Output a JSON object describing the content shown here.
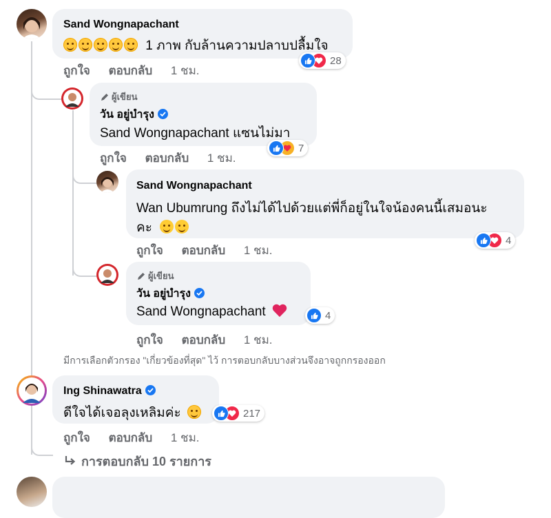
{
  "comments": [
    {
      "author": "Sand Wongnapachant",
      "text": "1 ภาพ กับล้านความปลาบปลื้มใจ",
      "reaction_count": "28",
      "like_label": "ถูกใจ",
      "reply_label": "ตอบกลับ",
      "time": "1 ชม."
    },
    {
      "author_tag": "ผู้เขียน",
      "author": "วัน อยู่บำรุง",
      "mention": "Sand Wongnapachant",
      "text": "แซนไม่มา",
      "reaction_count": "7",
      "like_label": "ถูกใจ",
      "reply_label": "ตอบกลับ",
      "time": "1 ชม."
    },
    {
      "author": "Sand Wongnapachant",
      "mention": "Wan Ubumrung",
      "text_line1": "ถึงไม่ได้ไปด้วยแต่พี่ก็อยู่ในใจน้องคนนี้เสมอนะ",
      "text_line2": "คะ",
      "reaction_count": "4",
      "like_label": "ถูกใจ",
      "reply_label": "ตอบกลับ",
      "time": "1 ชม."
    },
    {
      "author_tag": "ผู้เขียน",
      "author": "วัน อยู่บำรุง",
      "mention": "Sand Wongnapachant",
      "reaction_count": "4",
      "like_label": "ถูกใจ",
      "reply_label": "ตอบกลับ",
      "time": "1 ชม."
    },
    {
      "author": "Ing Shinawatra",
      "text": "ดีใจได้เจอลุงเหลิมค่ะ",
      "reaction_count": "217",
      "like_label": "ถูกใจ",
      "reply_label": "ตอบกลับ",
      "time": "1 ชม."
    }
  ],
  "filter_note": "มีการเลือกตัวกรอง \"เกี่ยวข้องที่สุด\" ไว้ การตอบกลับบางส่วนจึงอาจถูกกรองออก",
  "more_replies": "การตอบกลับ 10 รายการ",
  "colors": {
    "like": "#1877f2",
    "love": "#f02849",
    "bubble": "#f0f2f5",
    "secondary_text": "#65676b"
  }
}
